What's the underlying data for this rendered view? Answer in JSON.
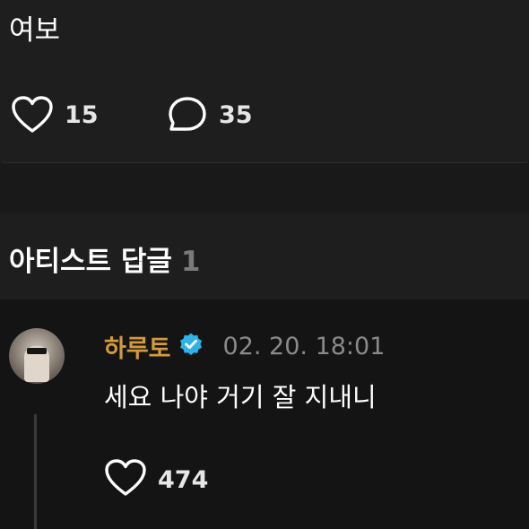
{
  "post": {
    "text": "여보",
    "like_count": "15",
    "comment_count": "35"
  },
  "artist_replies": {
    "title": "아티스트 답글",
    "count": "1"
  },
  "reply": {
    "author": "하루토",
    "timestamp": "02. 20. 18:01",
    "text": "세요 나야 거기 잘 지내니",
    "like_count": "474"
  },
  "colors": {
    "author_accent": "#d49a3c",
    "verified_badge": "#2fb2e6",
    "background": "#141414"
  },
  "icons": {
    "post_like": "heart-outline-icon",
    "post_comment": "speech-bubble-icon",
    "verified": "verified-badge-icon",
    "reply_like": "heart-outline-icon"
  }
}
